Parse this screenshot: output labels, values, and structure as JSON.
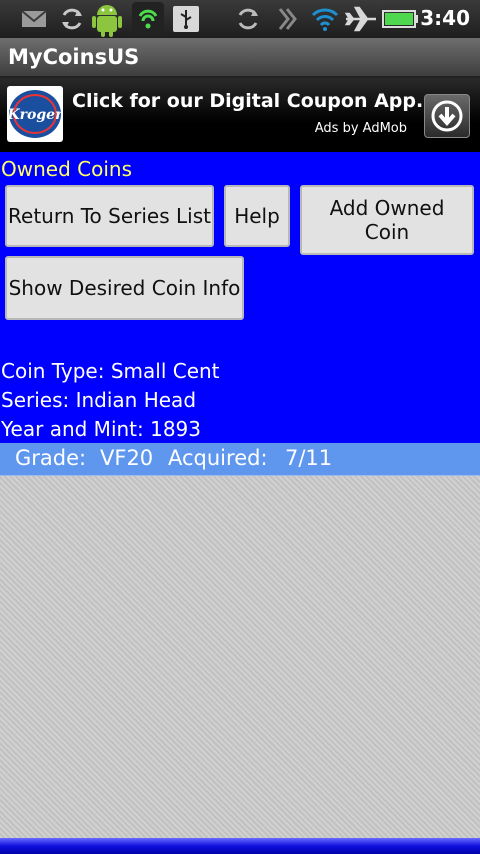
{
  "status_bar": {
    "time": "3:40",
    "icons": [
      "gmail-icon",
      "sync-icon",
      "android-icon",
      "shield-icon",
      "usb-icon",
      "rotate-icon",
      "signal-icon",
      "wifi-icon",
      "airplane-icon",
      "battery-icon"
    ]
  },
  "app": {
    "title": "MyCoinsUS"
  },
  "ad": {
    "logo_text": "Kroger",
    "headline": "Click for our Digital Coupon App.",
    "sub": "Ads by AdMob"
  },
  "screen": {
    "title": "Owned Coins",
    "buttons": {
      "return": "Return To Series List",
      "help": "Help",
      "add": "Add Owned Coin",
      "desired": "Show Desired Coin Info"
    },
    "coin_type": "Coin Type: Small Cent",
    "series": "Series: Indian Head",
    "year_mint": "Year and Mint: 1893"
  },
  "owned_list": [
    {
      "grade_label": "Grade:",
      "grade": "VF20",
      "acquired_label": "Acquired:",
      "acquired": "7/11"
    }
  ],
  "colors": {
    "background": "#0000ff",
    "title_text": "#ffff66",
    "row_highlight": "#5f97ef",
    "list_background": "#c9c9c9"
  }
}
